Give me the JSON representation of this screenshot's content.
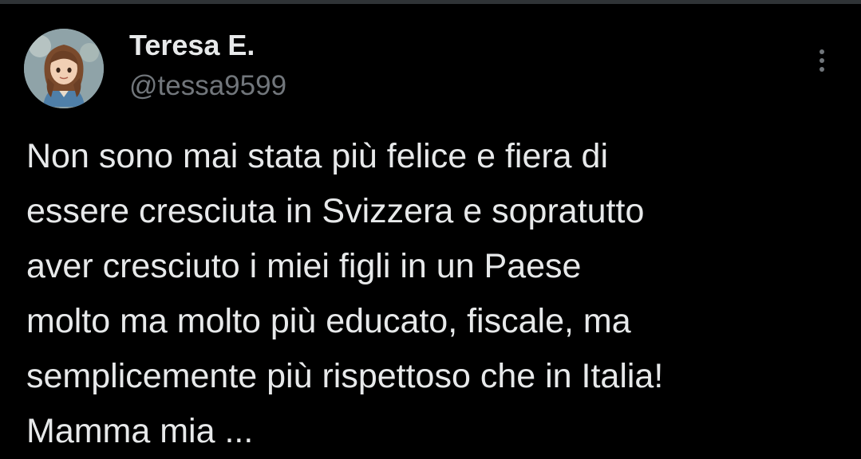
{
  "tweet": {
    "author": {
      "display_name": "Teresa E.",
      "handle": "@tessa9599",
      "avatar_icon": "illustrated-woman-avatar"
    },
    "more_icon": "vertical-ellipsis-icon",
    "text": "Non sono mai stata più felice e fiera di\nessere cresciuta in Svizzera e sopratutto\naver cresciuto i miei figli in un Paese\nmolto ma molto più educato, fiscale, ma\nsemplicemente più rispettoso che in Italia!\nMamma mia ..."
  },
  "theme": {
    "background": "#000000",
    "primary_text": "#e7e9ea",
    "secondary_text": "#71767b"
  }
}
